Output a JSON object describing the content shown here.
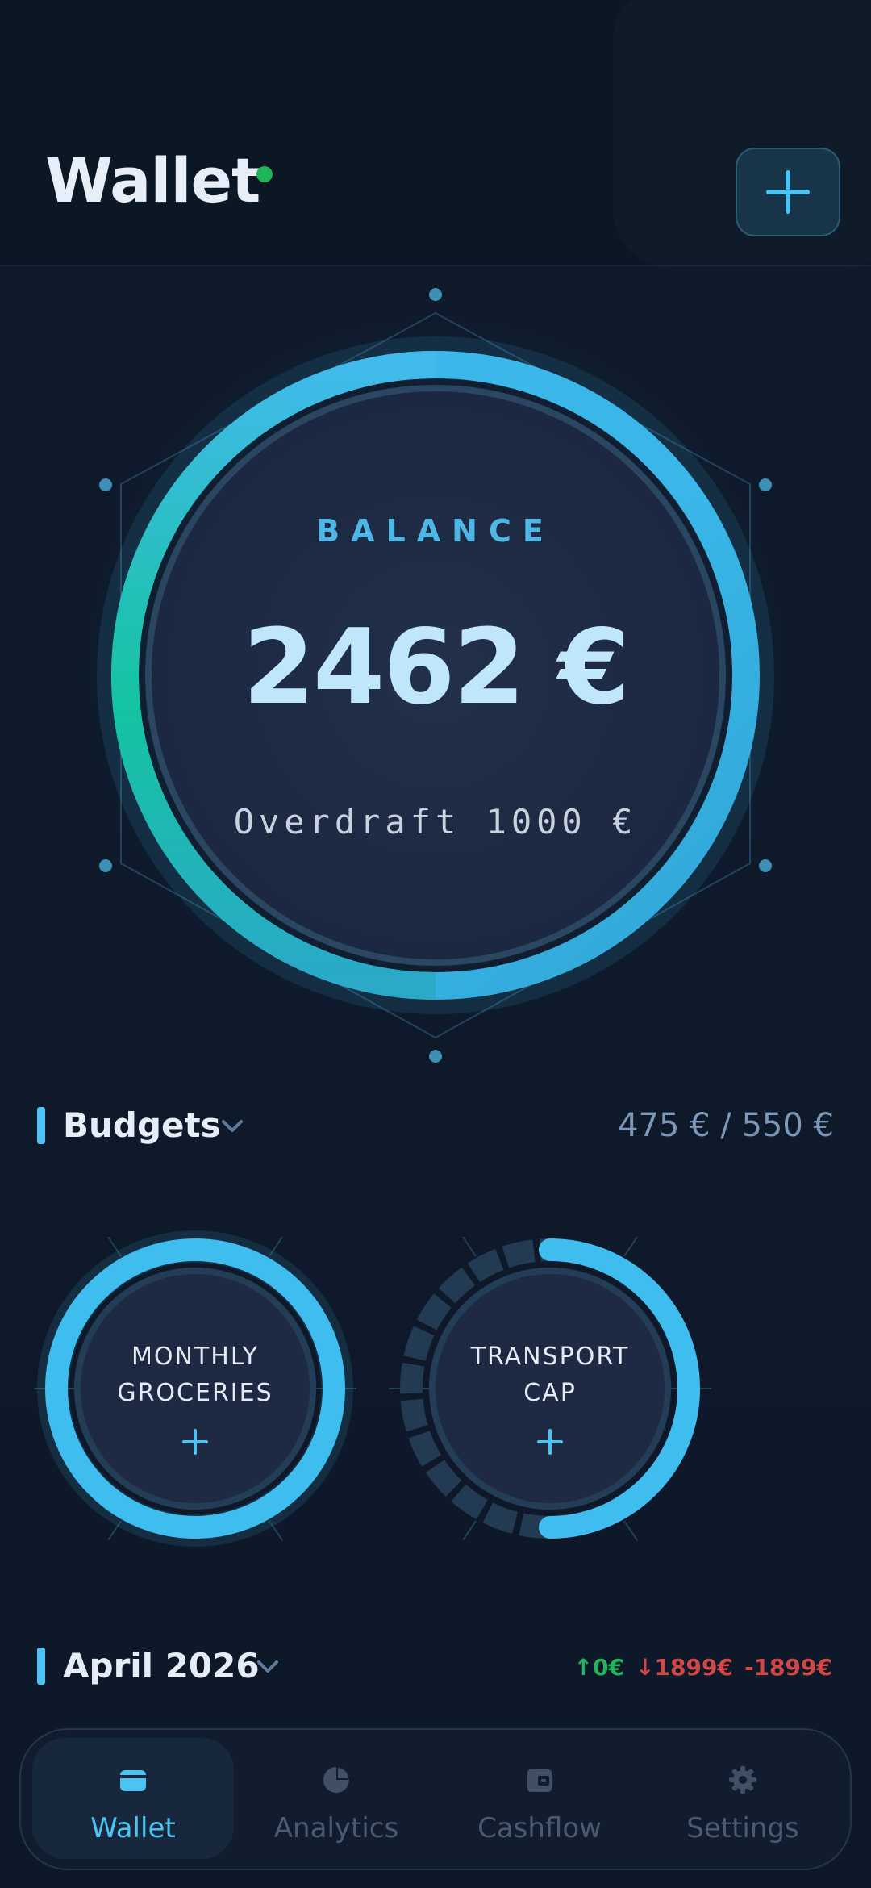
{
  "header": {
    "title": "Wallet",
    "add_icon": "plus-icon"
  },
  "balance": {
    "label": "BALANCE",
    "amount": "2462 €",
    "overdraft": "Overdraft 1000 €"
  },
  "budgets": {
    "title": "Budgets",
    "summary": "475 € / 550 €",
    "items": [
      {
        "name_line1": "MONTHLY",
        "name_line2": "GROCERIES",
        "progress": 1.0
      },
      {
        "name_line1": "TRANSPORT",
        "name_line2": "CAP",
        "progress": 0.5
      }
    ]
  },
  "period": {
    "title": "April 2026",
    "income": "↑0€",
    "expense": "↓1899€",
    "net": "-1899€"
  },
  "nav": {
    "items": [
      {
        "label": "Wallet",
        "icon": "wallet-icon",
        "active": true
      },
      {
        "label": "Analytics",
        "icon": "pie-chart-icon",
        "active": false
      },
      {
        "label": "Cashflow",
        "icon": "cashflow-icon",
        "active": false
      },
      {
        "label": "Settings",
        "icon": "gear-icon",
        "active": false
      }
    ]
  },
  "colors": {
    "accent": "#4cc3f2",
    "teal": "#14c3a0",
    "income": "#22b45a",
    "expense": "#d04848",
    "online": "#1fb454"
  }
}
